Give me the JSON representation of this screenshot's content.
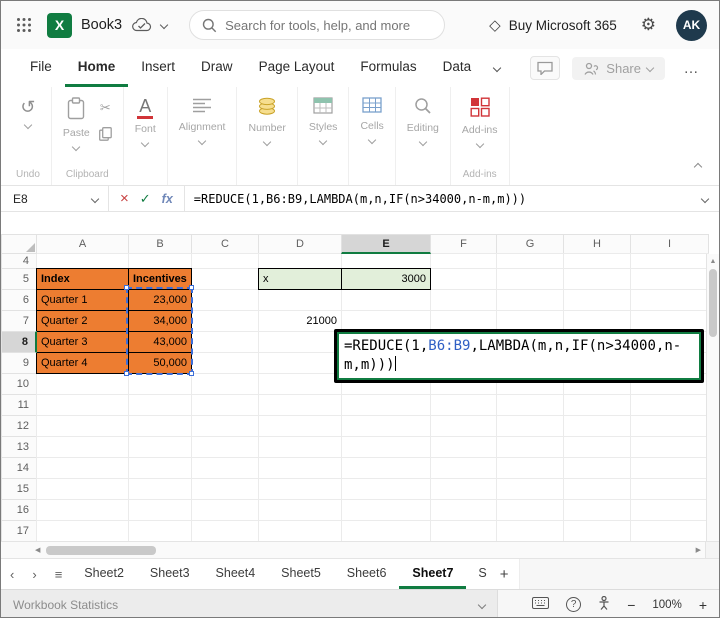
{
  "colors": {
    "excel_green": "#107C41",
    "orange_fill": "#ED7D31",
    "green_fill": "#E2EFDA",
    "reference_blue": "#3E6FD8",
    "styled_cell_border": "#000000"
  },
  "icons": {
    "excel_x": "X",
    "diamond": "◇",
    "gear": "⚙",
    "undo": "↺",
    "cut": "✂",
    "cancel": "×",
    "confirm": "✓",
    "hamburger": "≡",
    "chevron_left": "‹",
    "chevron_right": "›",
    "up_arrow": "▲",
    "left_arrow": "◀",
    "right_arrow": "▶",
    "plus": "+",
    "minus": "−",
    "more": "…",
    "help": "?",
    "font_a": "A"
  },
  "topbar": {
    "workbook_name": "Book3",
    "search_placeholder": "Search for tools, help, and more",
    "buy_label": "Buy Microsoft 365",
    "avatar_initials": "AK"
  },
  "menubar": {
    "tabs": [
      {
        "label": "File"
      },
      {
        "label": "Home",
        "active": true
      },
      {
        "label": "Insert"
      },
      {
        "label": "Draw"
      },
      {
        "label": "Page Layout"
      },
      {
        "label": "Formulas"
      },
      {
        "label": "Data"
      }
    ],
    "share_label": "Share"
  },
  "ribbon": {
    "undo_group": "Undo",
    "clipboard_group": "Clipboard",
    "paste": "Paste",
    "font": "Font",
    "alignment": "Alignment",
    "number": "Number",
    "styles": "Styles",
    "cells": "Cells",
    "editing": "Editing",
    "addins": "Add-ins",
    "addins_group": "Add-ins"
  },
  "formula_bar": {
    "name_box": "E8",
    "fx_label": "fx",
    "pre": "=REDUCE(1,",
    "ref": "B6:B9",
    "post": ",LAMBDA(m,n,IF(n>34000,n-m,m)))"
  },
  "grid": {
    "columns": [
      "A",
      "B",
      "C",
      "D",
      "E",
      "F",
      "G",
      "H",
      "I"
    ],
    "rows": [
      "4",
      "5",
      "6",
      "7",
      "8",
      "9",
      "10",
      "11",
      "12",
      "13",
      "14",
      "15",
      "16",
      "17"
    ],
    "selected_column": "E",
    "selected_row": "8",
    "active_cell": "E8",
    "highlighted_range": "B6:B9",
    "cells": [
      {
        "ref": "A5",
        "text": "Index",
        "fill": "orange",
        "bold": true
      },
      {
        "ref": "B5",
        "text": "Incentives",
        "fill": "orange",
        "bold": true
      },
      {
        "ref": "A6",
        "text": "Quarter 1",
        "fill": "orange"
      },
      {
        "ref": "B6",
        "text": "23,000",
        "fill": "orange",
        "align": "right"
      },
      {
        "ref": "A7",
        "text": "Quarter 2",
        "fill": "orange"
      },
      {
        "ref": "B7",
        "text": "34,000",
        "fill": "orange",
        "align": "right"
      },
      {
        "ref": "A8",
        "text": "Quarter 3",
        "fill": "orange"
      },
      {
        "ref": "B8",
        "text": "43,000",
        "fill": "orange",
        "align": "right"
      },
      {
        "ref": "A9",
        "text": "Quarter 4",
        "fill": "orange"
      },
      {
        "ref": "B9",
        "text": "50,000",
        "fill": "orange",
        "align": "right"
      },
      {
        "ref": "D5",
        "text": "x",
        "fill": "green"
      },
      {
        "ref": "E5",
        "text": "3000",
        "fill": "green",
        "align": "right"
      },
      {
        "ref": "D7",
        "text": "21000",
        "align": "right"
      }
    ]
  },
  "sheet_tabs": {
    "tabs": [
      {
        "label": "Sheet2"
      },
      {
        "label": "Sheet3"
      },
      {
        "label": "Sheet4"
      },
      {
        "label": "Sheet5"
      },
      {
        "label": "Sheet6"
      },
      {
        "label": "Sheet7",
        "active": true
      },
      {
        "label": "S",
        "partial": true
      }
    ]
  },
  "status_bar": {
    "left_label": "Workbook Statistics",
    "zoom_level": "100%"
  }
}
